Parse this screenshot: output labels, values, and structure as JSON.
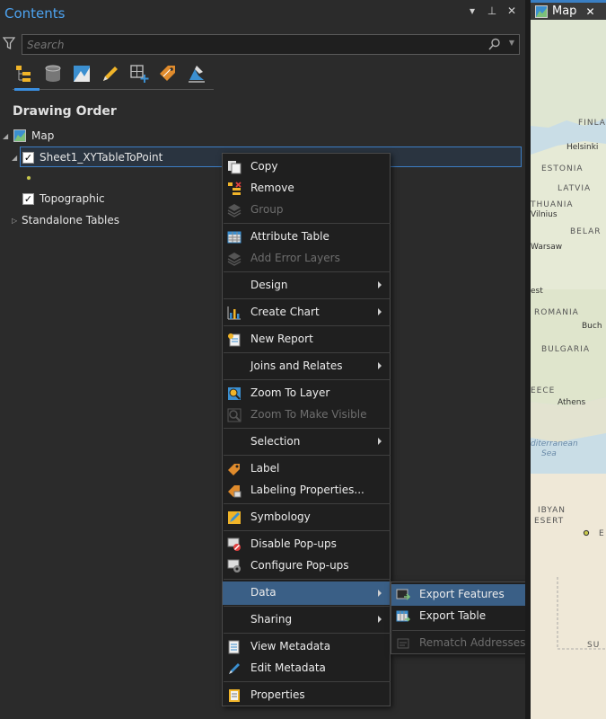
{
  "pane": {
    "title": "Contents",
    "search_placeholder": "Search",
    "heading": "Drawing Order"
  },
  "tree": {
    "map": "Map",
    "layer": "Sheet1_XYTableToPoint",
    "basemap": "Topographic",
    "standalone": "Standalone Tables"
  },
  "menu": {
    "items": [
      {
        "label": "Copy",
        "enabled": true
      },
      {
        "label": "Remove",
        "enabled": true
      },
      {
        "label": "Group",
        "enabled": false
      },
      {
        "label": "Attribute Table",
        "enabled": true
      },
      {
        "label": "Add Error Layers",
        "enabled": false
      },
      {
        "label": "Design",
        "enabled": true
      },
      {
        "label": "Create Chart",
        "enabled": true
      },
      {
        "label": "New Report",
        "enabled": true
      },
      {
        "label": "Joins and Relates",
        "enabled": true
      },
      {
        "label": "Zoom To Layer",
        "enabled": true
      },
      {
        "label": "Zoom To Make Visible",
        "enabled": false
      },
      {
        "label": "Selection",
        "enabled": true
      },
      {
        "label": "Label",
        "enabled": true
      },
      {
        "label": "Labeling Properties...",
        "enabled": true
      },
      {
        "label": "Symbology",
        "enabled": true
      },
      {
        "label": "Disable Pop-ups",
        "enabled": true
      },
      {
        "label": "Configure Pop-ups",
        "enabled": true
      },
      {
        "label": "Data",
        "enabled": true
      },
      {
        "label": "Sharing",
        "enabled": true
      },
      {
        "label": "View Metadata",
        "enabled": true
      },
      {
        "label": "Edit Metadata",
        "enabled": true
      },
      {
        "label": "Properties",
        "enabled": true
      }
    ]
  },
  "submenu": {
    "items": [
      {
        "label": "Export Features",
        "enabled": true
      },
      {
        "label": "Export Table",
        "enabled": true
      },
      {
        "label": "Rematch Addresses...",
        "enabled": false
      }
    ]
  },
  "map_view": {
    "tab_label": "Map",
    "labels": [
      "FINLAN",
      "Helsinki",
      "ESTONIA",
      "LATVIA",
      "THUANIA",
      "Vilnius",
      "BELAR",
      "Warsaw",
      "est",
      "ROMANIA",
      "Buch",
      "BULGARIA",
      "EECE",
      "Athens",
      "diterranean",
      "Sea",
      "IBYAN",
      "ESERT",
      "E",
      "SU"
    ]
  }
}
